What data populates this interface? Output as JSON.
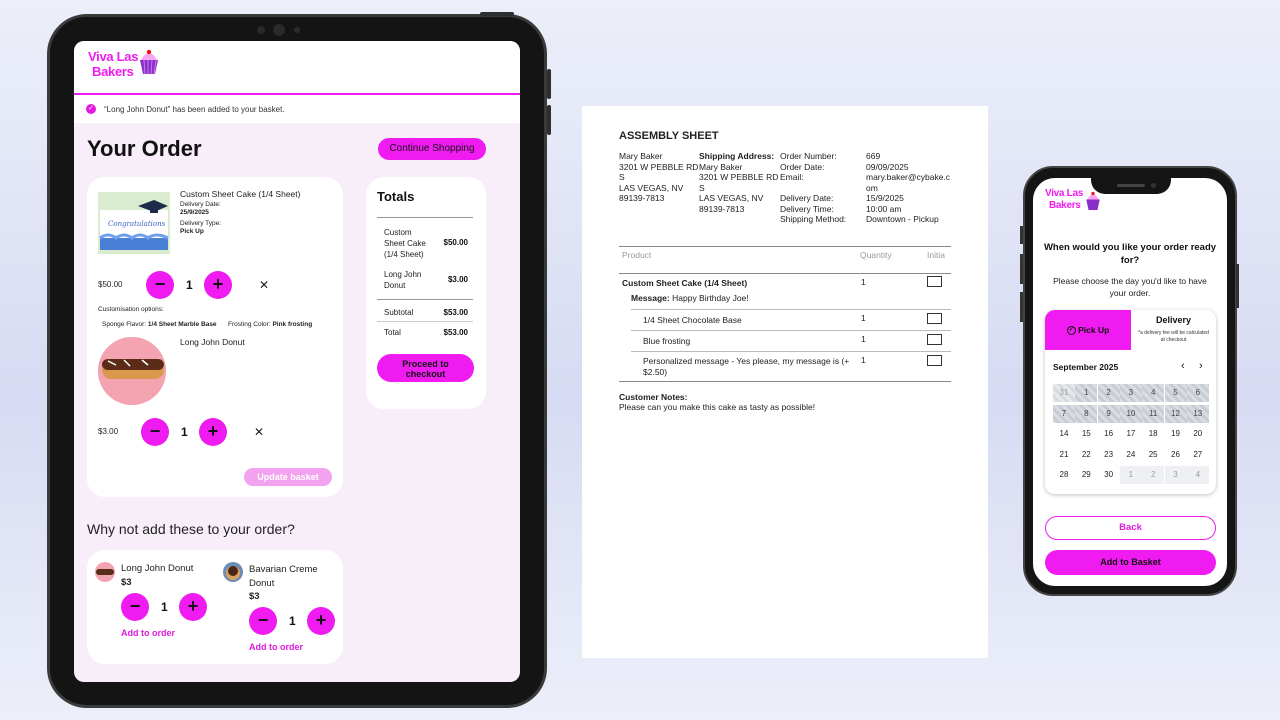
{
  "brand": {
    "logo_line1": "Viva Las",
    "logo_line2": "Bakers",
    "accent": "#f01bf0"
  },
  "tablet": {
    "notice": "“Long John Donut” has been added to your basket.",
    "title": "Your Order",
    "continue_shopping": "Continue Shopping",
    "items": [
      {
        "name": "Custom Sheet Cake (1/4 Sheet)",
        "delivery_date_label": "Delivery Date:",
        "delivery_date": "25/9/2025",
        "delivery_type_label": "Delivery Type:",
        "delivery_type": "Pick Up",
        "price": "$50.00",
        "qty": "1"
      },
      {
        "name": "Long John Donut",
        "price": "$3.00",
        "qty": "1"
      }
    ],
    "customisation_label": "Customisation options:",
    "sponge_label": "Sponge Flavor:",
    "sponge_value": "1/4 Sheet Marble Base",
    "frosting_label": "Frosting Color:",
    "frosting_value": "Pink frosting",
    "update_basket": "Update basket",
    "totals": {
      "title": "Totals",
      "rows": [
        {
          "name": "Custom Sheet Cake (1/4 Sheet)",
          "value": "$50.00"
        },
        {
          "name": "Long John Donut",
          "value": "$3.00"
        }
      ],
      "subtotal_label": "Subtotal",
      "subtotal": "$53.00",
      "total_label": "Total",
      "total": "$53.00",
      "checkout": "Proceed to checkout"
    },
    "upsell_title": "Why not add these to your order?",
    "upsell": [
      {
        "name": "Long John Donut",
        "price": "$3",
        "qty": "1",
        "add": "Add to order"
      },
      {
        "name": "Bavarian Creme Donut",
        "price": "$3",
        "qty": "1",
        "add": "Add to order"
      }
    ]
  },
  "sheet": {
    "title": "ASSEMBLY SHEET",
    "billing": [
      "Mary Baker",
      "3201 W PEBBLE RD",
      "S",
      "LAS VEGAS, NV",
      "89139-7813"
    ],
    "shipping_label": "Shipping Address:",
    "shipping": [
      "Mary Baker",
      "3201 W PEBBLE RD",
      "S",
      "LAS VEGAS, NV",
      "89139-7813"
    ],
    "meta_labels": [
      "Order Number:",
      "Order Date:",
      "Email:",
      "",
      "Delivery Date:",
      "Delivery Time:",
      "Shipping Method:"
    ],
    "meta_values": [
      "669",
      "09/09/2025",
      "mary.baker@cybake.c",
      "om",
      "15/9/2025",
      "10:00 am",
      "Downtown - Pickup"
    ],
    "col_product": "Product",
    "col_quantity": "Quantity",
    "col_initial": "Initia",
    "product_main": "Custom Sheet Cake (1/4 Sheet)",
    "product_qty": "1",
    "message_label": "Message:",
    "message": "Happy Birthday Joe!",
    "options": [
      {
        "name": "1/4 Sheet Chocolate Base",
        "qty": "1"
      },
      {
        "name": "Blue frosting",
        "qty": "1"
      },
      {
        "name": "Personalized message - Yes please, my message is (+",
        "name2": "$2.50)",
        "qty": "1"
      }
    ],
    "notes_label": "Customer Notes:",
    "notes": "Please can you make this cake as tasty as possible!"
  },
  "phone": {
    "question": "When would you like your order ready for?",
    "instruction": "Please choose the day you'd like to have your order.",
    "pickup": "Pick Up",
    "delivery": "Delivery",
    "delivery_note": "*a delivery fee will be calculated at checkout",
    "month": "September 2025",
    "calendar": [
      [
        "31",
        "1",
        "2",
        "3",
        "4",
        "5",
        "6"
      ],
      [
        "7",
        "8",
        "9",
        "10",
        "11",
        "12",
        "13"
      ],
      [
        "14",
        "15",
        "16",
        "17",
        "18",
        "19",
        "20"
      ],
      [
        "21",
        "22",
        "23",
        "24",
        "25",
        "26",
        "27"
      ],
      [
        "28",
        "29",
        "30",
        "1",
        "2",
        "3",
        "4"
      ]
    ],
    "back": "Back",
    "add_to_basket": "Add to Basket"
  }
}
